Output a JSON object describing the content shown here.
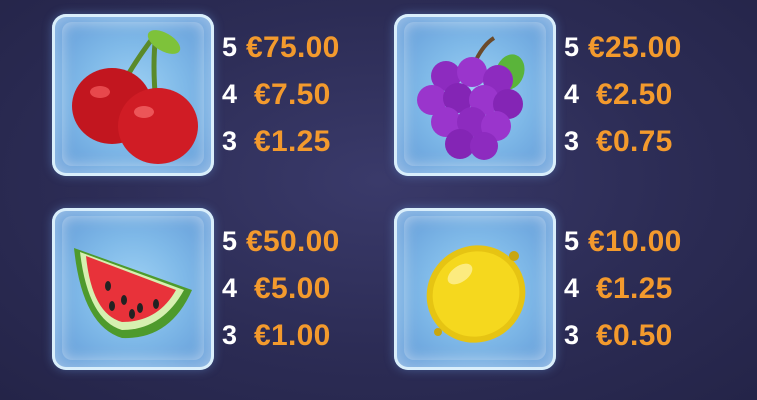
{
  "paytable": {
    "symbols": [
      {
        "icon": "cherry-icon",
        "rows": [
          {
            "count": "5",
            "payout": "€75.00"
          },
          {
            "count": "4",
            "payout": "€7.50"
          },
          {
            "count": "3",
            "payout": "€1.25"
          }
        ]
      },
      {
        "icon": "grapes-icon",
        "rows": [
          {
            "count": "5",
            "payout": "€25.00"
          },
          {
            "count": "4",
            "payout": "€2.50"
          },
          {
            "count": "3",
            "payout": "€0.75"
          }
        ]
      },
      {
        "icon": "watermelon-icon",
        "rows": [
          {
            "count": "5",
            "payout": "€50.00"
          },
          {
            "count": "4",
            "payout": "€5.00"
          },
          {
            "count": "3",
            "payout": "€1.00"
          }
        ]
      },
      {
        "icon": "lemon-icon",
        "rows": [
          {
            "count": "5",
            "payout": "€10.00"
          },
          {
            "count": "4",
            "payout": "€1.25"
          },
          {
            "count": "3",
            "payout": "€0.50"
          }
        ]
      }
    ]
  },
  "colors": {
    "payout": "#f39a2d",
    "count": "#ffffff",
    "background": "#2c2c55",
    "ice": "#7fb9e8"
  }
}
